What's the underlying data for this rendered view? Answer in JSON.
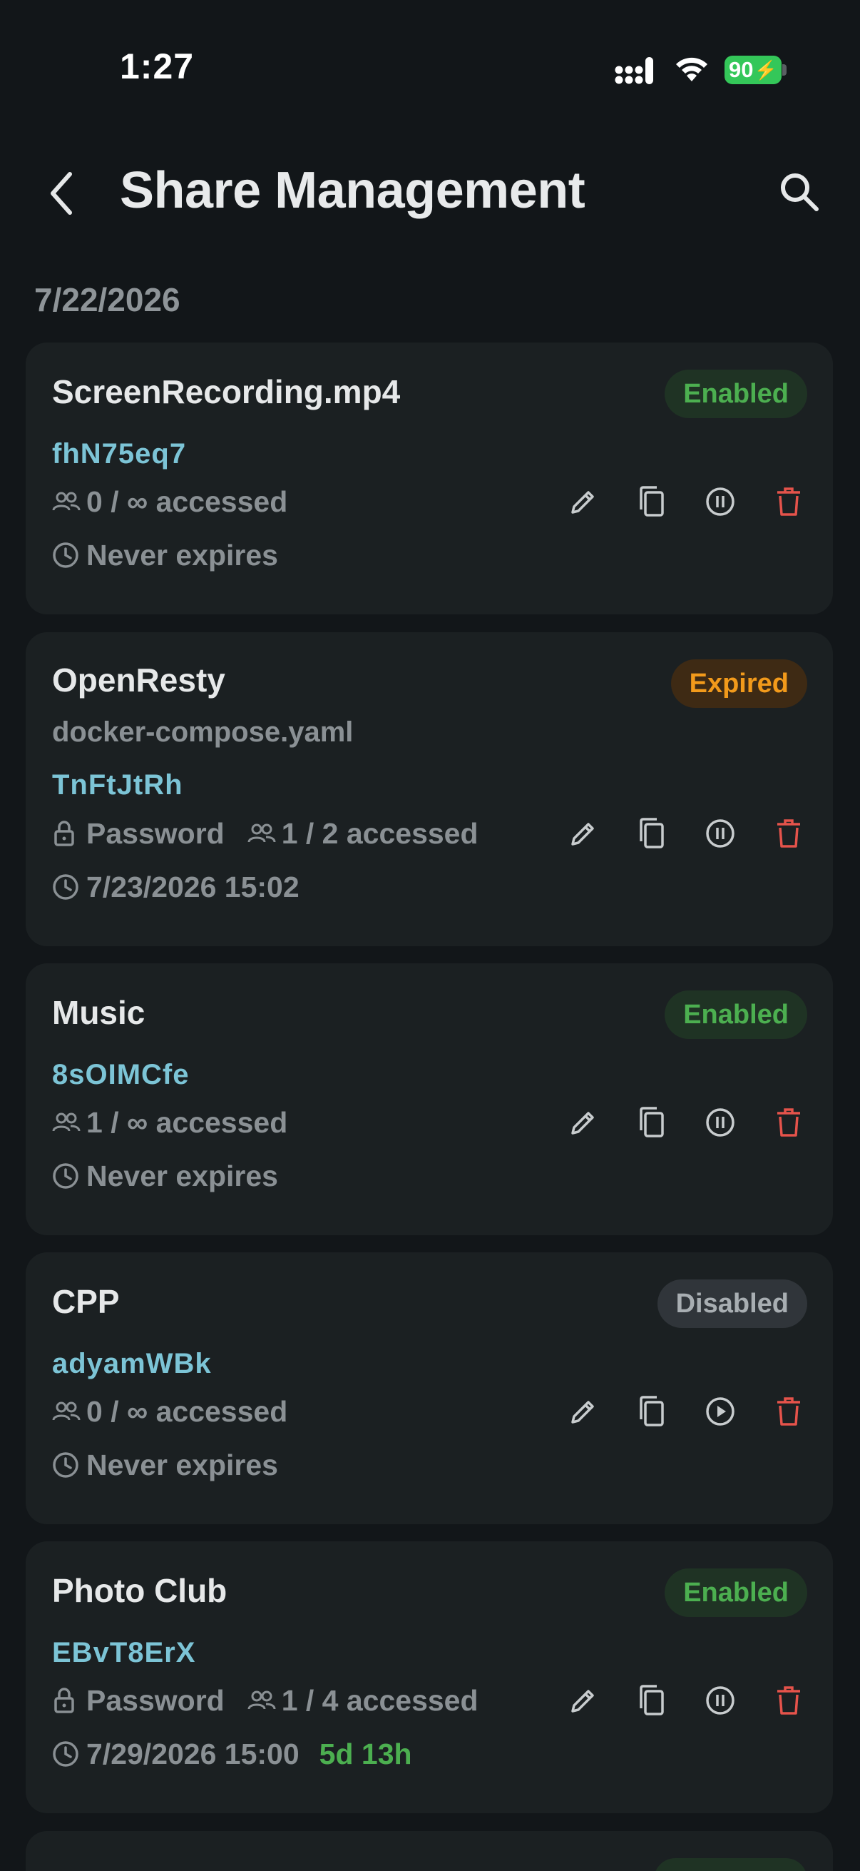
{
  "status": {
    "time": "1:27",
    "battery": "90"
  },
  "header": {
    "title": "Share Management"
  },
  "date_group": "7/22/2026",
  "shares": [
    {
      "name": "ScreenRecording.mp4",
      "subtitle": "",
      "code": "fhN75eq7",
      "status": "Enabled",
      "status_type": "enabled",
      "password": false,
      "password_label": "",
      "access": "0 / ∞ accessed",
      "expires": "Never expires",
      "remaining": "",
      "toggle_icon": "pause-icon"
    },
    {
      "name": "OpenResty",
      "subtitle": "docker-compose.yaml",
      "code": "TnFtJtRh",
      "status": "Expired",
      "status_type": "expired",
      "password": true,
      "password_label": "Password",
      "access": "1 / 2 accessed",
      "expires": "7/23/2026 15:02",
      "remaining": "",
      "toggle_icon": "pause-icon"
    },
    {
      "name": "Music",
      "subtitle": "",
      "code": "8sOIMCfe",
      "status": "Enabled",
      "status_type": "enabled",
      "password": false,
      "password_label": "",
      "access": "1 / ∞ accessed",
      "expires": "Never expires",
      "remaining": "",
      "toggle_icon": "pause-icon"
    },
    {
      "name": "CPP",
      "subtitle": "",
      "code": "adyamWBk",
      "status": "Disabled",
      "status_type": "disabled",
      "password": false,
      "password_label": "",
      "access": "0 / ∞ accessed",
      "expires": "Never expires",
      "remaining": "",
      "toggle_icon": "play-icon"
    },
    {
      "name": "Photo Club",
      "subtitle": "",
      "code": "EBvT8ErX",
      "status": "Enabled",
      "status_type": "enabled",
      "password": true,
      "password_label": "Password",
      "access": "1 / 4 accessed",
      "expires": "7/29/2026 15:00",
      "remaining": "5d 13h",
      "toggle_icon": "pause-icon"
    }
  ],
  "colors": {
    "accent_code": "#7cc4d6",
    "enabled": "#4caf50",
    "expired": "#f29a1b",
    "delete": "#e5534b",
    "background": "#121619",
    "card": "#1b2022"
  }
}
